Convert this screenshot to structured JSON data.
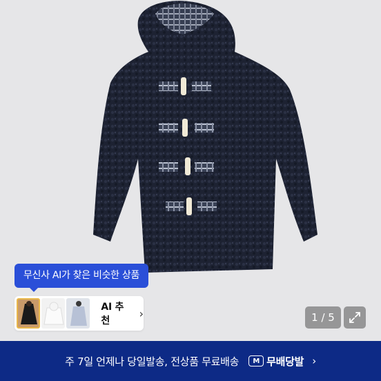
{
  "image": {
    "subject": "navy teddy fleece hooded duffle coat with plaid panels and toggle buttons",
    "background_color": "#e6e6e8",
    "coat_color": "#1c2233"
  },
  "ai_tooltip": {
    "text": "무신사 AI가 찾은 비슷한 상품"
  },
  "ai_recommend": {
    "label": "AI 추천",
    "chevron_icon": "chevron-right-icon"
  },
  "pager": {
    "text": "1 / 5"
  },
  "expand_icon": "expand-icon",
  "banner": {
    "text": "주 7일 언제나 당일발송, 전상품 무료배송",
    "badge_text": "M",
    "brand": "무배당발",
    "chevron_icon": "chevron-right-icon",
    "background": "#0d2a86"
  }
}
